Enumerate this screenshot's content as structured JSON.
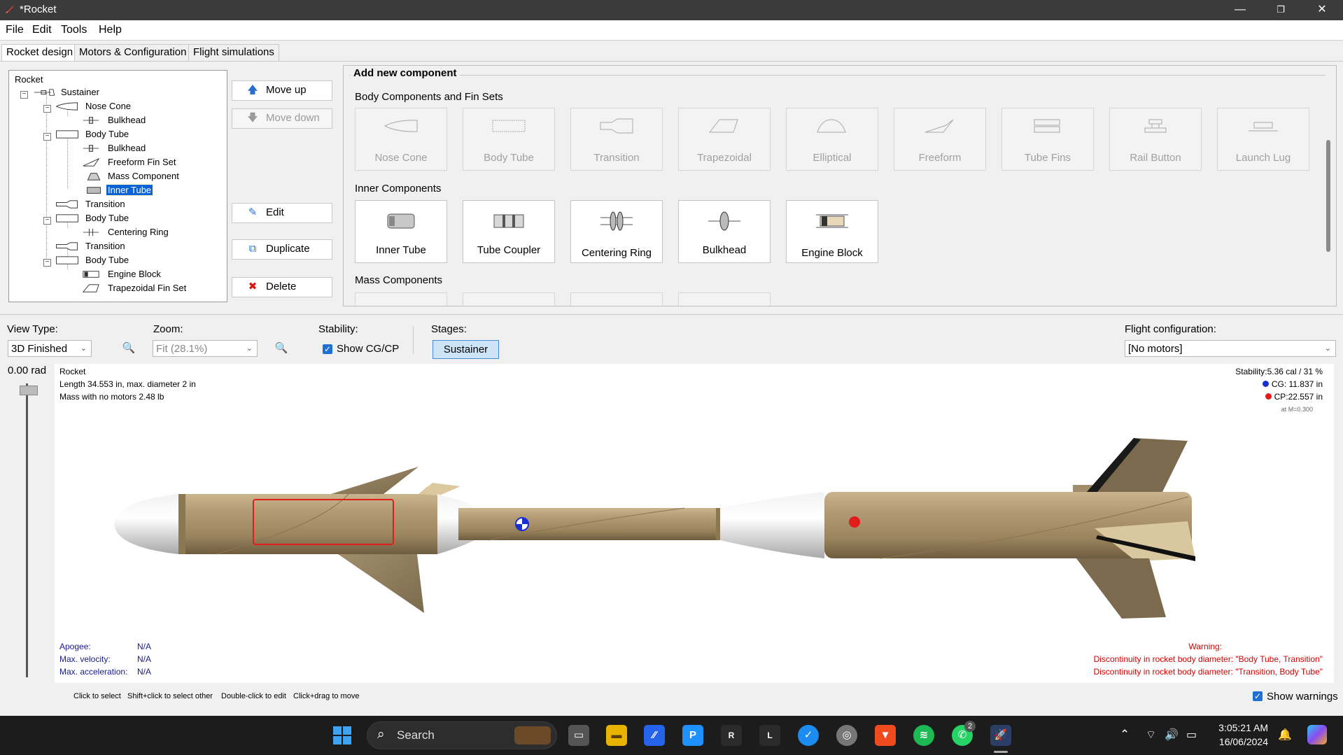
{
  "window": {
    "title": "*Rocket",
    "minimize": "—",
    "restore": "❐",
    "close": "✕"
  },
  "menu": {
    "items": [
      "File",
      "Edit",
      "Tools",
      "Help"
    ]
  },
  "tabs": [
    "Rocket design",
    "Motors & Configuration",
    "Flight simulations"
  ],
  "tree": {
    "root": "Rocket",
    "items": [
      {
        "label": "Sustainer"
      },
      {
        "label": "Nose Cone"
      },
      {
        "label": "Bulkhead"
      },
      {
        "label": "Body Tube"
      },
      {
        "label": "Bulkhead"
      },
      {
        "label": "Freeform Fin Set"
      },
      {
        "label": "Mass Component"
      },
      {
        "label": "Inner Tube",
        "selected": true
      },
      {
        "label": "Transition"
      },
      {
        "label": "Body Tube"
      },
      {
        "label": "Centering Ring"
      },
      {
        "label": "Transition"
      },
      {
        "label": "Body Tube"
      },
      {
        "label": "Engine Block"
      },
      {
        "label": "Trapezoidal Fin Set"
      }
    ]
  },
  "actions": {
    "move_up": "Move up",
    "move_down": "Move down",
    "edit": "Edit",
    "duplicate": "Duplicate",
    "delete": "Delete"
  },
  "add_component": {
    "title": "Add new component",
    "body_section": "Body Components and Fin Sets",
    "body_items": [
      "Nose Cone",
      "Body Tube",
      "Transition",
      "Trapezoidal",
      "Elliptical",
      "Freeform",
      "Tube Fins",
      "Rail Button",
      "Launch Lug"
    ],
    "inner_section": "Inner Components",
    "inner_items": [
      "Inner Tube",
      "Tube Coupler",
      "Centering Ring",
      "Bulkhead",
      "Engine Block"
    ],
    "mass_section": "Mass Components"
  },
  "view": {
    "view_type_label": "View Type:",
    "view_type_value": "3D Finished",
    "zoom_label": "Zoom:",
    "zoom_value": "Fit (28.1%)",
    "stability_label": "Stability:",
    "show_cgcp": "Show CG/CP",
    "stages_label": "Stages:",
    "stage_button": "Sustainer",
    "flight_config_label": "Flight configuration:",
    "flight_config_value": "[No motors]",
    "rotation": "0.00 rad"
  },
  "info": {
    "name": "Rocket",
    "length": "Length 34.553 in, max. diameter 2 in",
    "mass": "Mass with no motors 2.48 lb",
    "stability": "Stability:5.36 cal / 31 %",
    "cg": "CG: 11.837 in",
    "cp": "CP:22.557 in",
    "mach": "at M=0.300",
    "apogee_label": "Apogee:",
    "apogee": "N/A",
    "velocity_label": "Max. velocity:",
    "velocity": "N/A",
    "accel_label": "Max. acceleration:",
    "accel": "N/A",
    "warning_title": "Warning:",
    "warning_1": "Discontinuity in rocket body diameter:  \"Body Tube, Transition\"",
    "warning_2": "Discontinuity in rocket body diameter:  \"Transition, Body Tube\""
  },
  "hints": [
    "Click to select",
    "Shift+click to select other",
    "Double-click to edit",
    "Click+drag to move"
  ],
  "show_warnings": "Show warnings",
  "taskbar": {
    "search": "Search",
    "time": "3:05:21 AM",
    "date": "16/06/2024",
    "whatsapp_badge": "2"
  },
  "colors": {
    "accent": "#0a64d8",
    "cg": "#1a2fd1",
    "cp": "#e21b1b",
    "warning": "#d40000",
    "body_tube": "#a48e6c"
  }
}
